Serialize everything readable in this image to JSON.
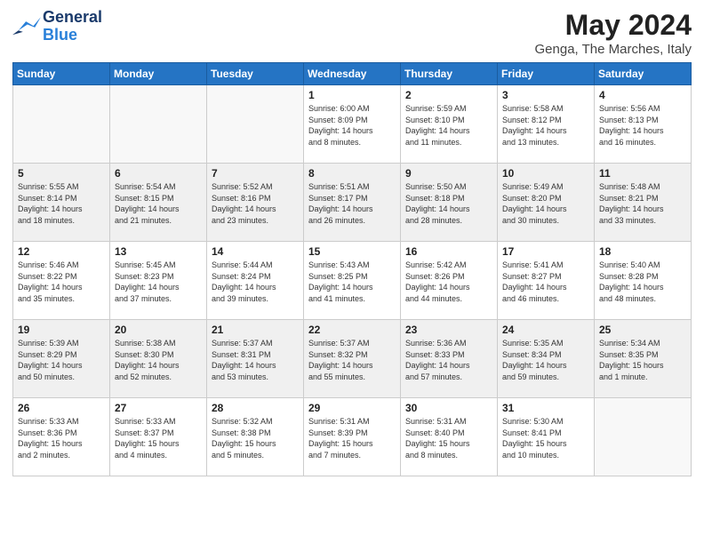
{
  "header": {
    "logo_text_general": "General",
    "logo_text_blue": "Blue",
    "month_year": "May 2024",
    "location": "Genga, The Marches, Italy"
  },
  "weekdays": [
    "Sunday",
    "Monday",
    "Tuesday",
    "Wednesday",
    "Thursday",
    "Friday",
    "Saturday"
  ],
  "weeks": [
    {
      "shaded": false,
      "days": [
        {
          "num": "",
          "info": ""
        },
        {
          "num": "",
          "info": ""
        },
        {
          "num": "",
          "info": ""
        },
        {
          "num": "1",
          "info": "Sunrise: 6:00 AM\nSunset: 8:09 PM\nDaylight: 14 hours\nand 8 minutes."
        },
        {
          "num": "2",
          "info": "Sunrise: 5:59 AM\nSunset: 8:10 PM\nDaylight: 14 hours\nand 11 minutes."
        },
        {
          "num": "3",
          "info": "Sunrise: 5:58 AM\nSunset: 8:12 PM\nDaylight: 14 hours\nand 13 minutes."
        },
        {
          "num": "4",
          "info": "Sunrise: 5:56 AM\nSunset: 8:13 PM\nDaylight: 14 hours\nand 16 minutes."
        }
      ]
    },
    {
      "shaded": true,
      "days": [
        {
          "num": "5",
          "info": "Sunrise: 5:55 AM\nSunset: 8:14 PM\nDaylight: 14 hours\nand 18 minutes."
        },
        {
          "num": "6",
          "info": "Sunrise: 5:54 AM\nSunset: 8:15 PM\nDaylight: 14 hours\nand 21 minutes."
        },
        {
          "num": "7",
          "info": "Sunrise: 5:52 AM\nSunset: 8:16 PM\nDaylight: 14 hours\nand 23 minutes."
        },
        {
          "num": "8",
          "info": "Sunrise: 5:51 AM\nSunset: 8:17 PM\nDaylight: 14 hours\nand 26 minutes."
        },
        {
          "num": "9",
          "info": "Sunrise: 5:50 AM\nSunset: 8:18 PM\nDaylight: 14 hours\nand 28 minutes."
        },
        {
          "num": "10",
          "info": "Sunrise: 5:49 AM\nSunset: 8:20 PM\nDaylight: 14 hours\nand 30 minutes."
        },
        {
          "num": "11",
          "info": "Sunrise: 5:48 AM\nSunset: 8:21 PM\nDaylight: 14 hours\nand 33 minutes."
        }
      ]
    },
    {
      "shaded": false,
      "days": [
        {
          "num": "12",
          "info": "Sunrise: 5:46 AM\nSunset: 8:22 PM\nDaylight: 14 hours\nand 35 minutes."
        },
        {
          "num": "13",
          "info": "Sunrise: 5:45 AM\nSunset: 8:23 PM\nDaylight: 14 hours\nand 37 minutes."
        },
        {
          "num": "14",
          "info": "Sunrise: 5:44 AM\nSunset: 8:24 PM\nDaylight: 14 hours\nand 39 minutes."
        },
        {
          "num": "15",
          "info": "Sunrise: 5:43 AM\nSunset: 8:25 PM\nDaylight: 14 hours\nand 41 minutes."
        },
        {
          "num": "16",
          "info": "Sunrise: 5:42 AM\nSunset: 8:26 PM\nDaylight: 14 hours\nand 44 minutes."
        },
        {
          "num": "17",
          "info": "Sunrise: 5:41 AM\nSunset: 8:27 PM\nDaylight: 14 hours\nand 46 minutes."
        },
        {
          "num": "18",
          "info": "Sunrise: 5:40 AM\nSunset: 8:28 PM\nDaylight: 14 hours\nand 48 minutes."
        }
      ]
    },
    {
      "shaded": true,
      "days": [
        {
          "num": "19",
          "info": "Sunrise: 5:39 AM\nSunset: 8:29 PM\nDaylight: 14 hours\nand 50 minutes."
        },
        {
          "num": "20",
          "info": "Sunrise: 5:38 AM\nSunset: 8:30 PM\nDaylight: 14 hours\nand 52 minutes."
        },
        {
          "num": "21",
          "info": "Sunrise: 5:37 AM\nSunset: 8:31 PM\nDaylight: 14 hours\nand 53 minutes."
        },
        {
          "num": "22",
          "info": "Sunrise: 5:37 AM\nSunset: 8:32 PM\nDaylight: 14 hours\nand 55 minutes."
        },
        {
          "num": "23",
          "info": "Sunrise: 5:36 AM\nSunset: 8:33 PM\nDaylight: 14 hours\nand 57 minutes."
        },
        {
          "num": "24",
          "info": "Sunrise: 5:35 AM\nSunset: 8:34 PM\nDaylight: 14 hours\nand 59 minutes."
        },
        {
          "num": "25",
          "info": "Sunrise: 5:34 AM\nSunset: 8:35 PM\nDaylight: 15 hours\nand 1 minute."
        }
      ]
    },
    {
      "shaded": false,
      "days": [
        {
          "num": "26",
          "info": "Sunrise: 5:33 AM\nSunset: 8:36 PM\nDaylight: 15 hours\nand 2 minutes."
        },
        {
          "num": "27",
          "info": "Sunrise: 5:33 AM\nSunset: 8:37 PM\nDaylight: 15 hours\nand 4 minutes."
        },
        {
          "num": "28",
          "info": "Sunrise: 5:32 AM\nSunset: 8:38 PM\nDaylight: 15 hours\nand 5 minutes."
        },
        {
          "num": "29",
          "info": "Sunrise: 5:31 AM\nSunset: 8:39 PM\nDaylight: 15 hours\nand 7 minutes."
        },
        {
          "num": "30",
          "info": "Sunrise: 5:31 AM\nSunset: 8:40 PM\nDaylight: 15 hours\nand 8 minutes."
        },
        {
          "num": "31",
          "info": "Sunrise: 5:30 AM\nSunset: 8:41 PM\nDaylight: 15 hours\nand 10 minutes."
        },
        {
          "num": "",
          "info": ""
        }
      ]
    }
  ]
}
